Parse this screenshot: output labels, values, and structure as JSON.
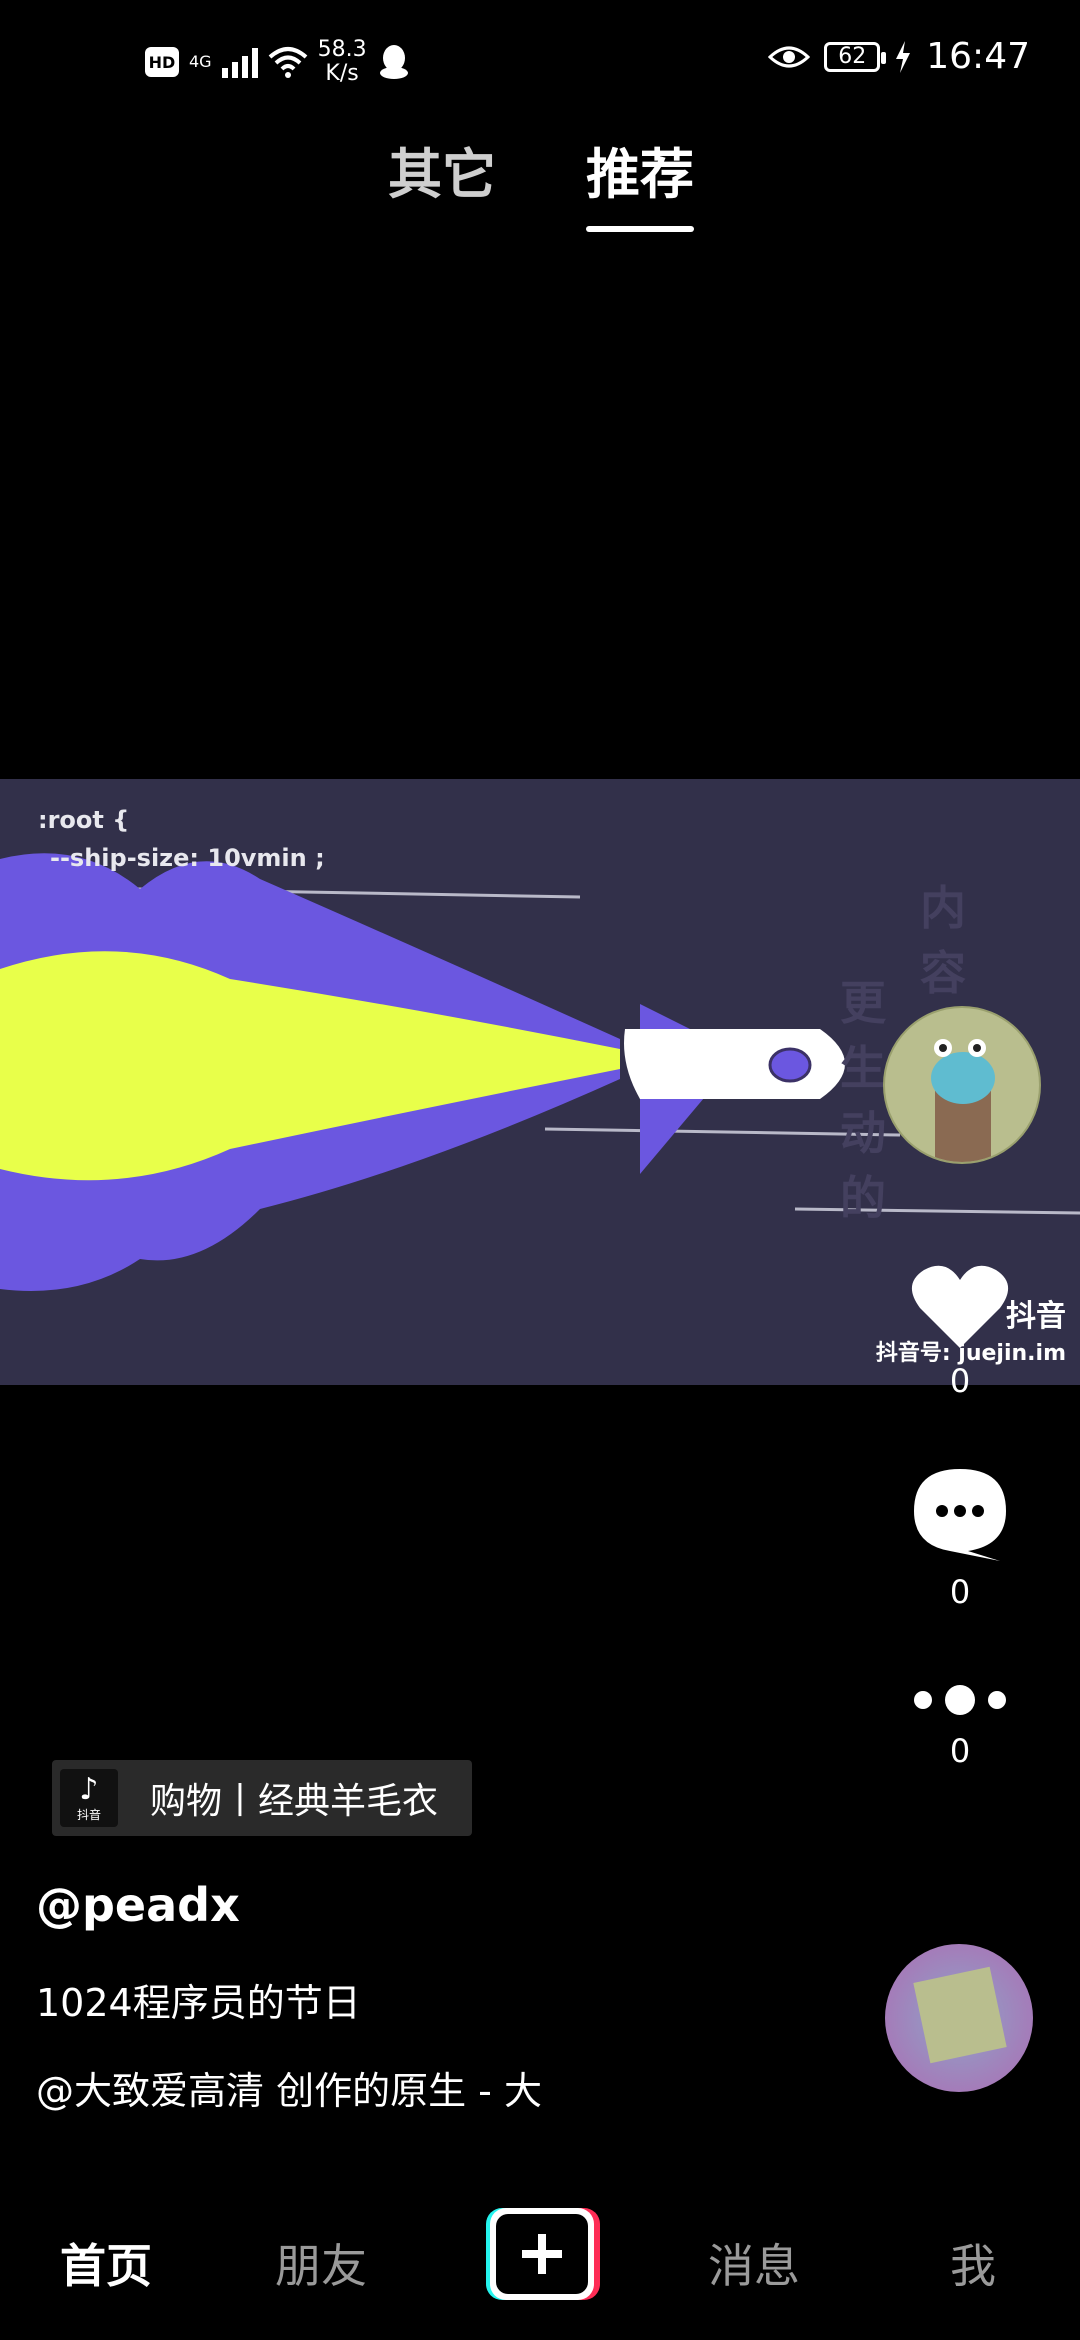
{
  "status_bar": {
    "hd": "HD",
    "network": "4G",
    "speed_value": "58.3",
    "speed_unit": "K/s",
    "battery": "62",
    "time": "16:47"
  },
  "top_tabs": {
    "other": "其它",
    "recommended": "推荐"
  },
  "video": {
    "code_line1": ":root {",
    "code_line2": "--ship-size: 10vmin ;",
    "watermark_brand": "抖音",
    "watermark_id": "抖音号: juejin.im",
    "colors": {
      "flame_outer": "#6b57e0",
      "flame_inner": "#e8ff4a",
      "background": "#32304a"
    }
  },
  "actions": {
    "like_count": "0",
    "comment_count": "0",
    "share_count": "0"
  },
  "shop": {
    "logo_text": "抖音",
    "label": "购物丨经典羊毛衣"
  },
  "post": {
    "author": "@peadx",
    "description": "1024程序员的节日",
    "music": "@大致爱高清 创作的原生 - 大"
  },
  "bottom_nav": {
    "home": "首页",
    "friends": "朋友",
    "messages": "消息",
    "me": "我"
  }
}
